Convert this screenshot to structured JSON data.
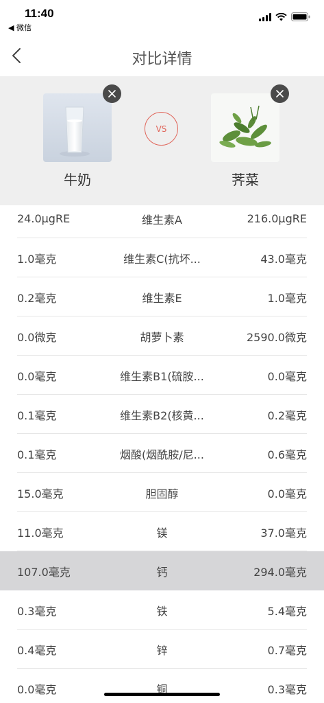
{
  "status_bar": {
    "time": "11:40",
    "back_app": "◀ 微信"
  },
  "nav": {
    "title": "对比详情",
    "back_icon": "chevron-left-icon"
  },
  "compare": {
    "left": {
      "name": "牛奶",
      "image": "milk-glass-image"
    },
    "right": {
      "name": "荠菜",
      "image": "shepherds-purse-image"
    },
    "vs_label": "VS",
    "accent": "#e0655a"
  },
  "rows": [
    {
      "left": "24.0μgRE",
      "name": "维生素A",
      "right": "216.0μgRE"
    },
    {
      "left": "1.0毫克",
      "name": "维生素C(抗坏...",
      "right": "43.0毫克"
    },
    {
      "left": "0.2毫克",
      "name": "维生素E",
      "right": "1.0毫克"
    },
    {
      "left": "0.0微克",
      "name": "胡萝卜素",
      "right": "2590.0微克"
    },
    {
      "left": "0.0毫克",
      "name": "维生素B1(硫胺...",
      "right": "0.0毫克"
    },
    {
      "left": "0.1毫克",
      "name": "维生素B2(核黄...",
      "right": "0.2毫克"
    },
    {
      "left": "0.1毫克",
      "name": "烟酸(烟酰胺/尼...",
      "right": "0.6毫克"
    },
    {
      "left": "15.0毫克",
      "name": "胆固醇",
      "right": "0.0毫克"
    },
    {
      "left": "11.0毫克",
      "name": "镁",
      "right": "37.0毫克"
    },
    {
      "left": "107.0毫克",
      "name": "钙",
      "right": "294.0毫克"
    },
    {
      "left": "0.3毫克",
      "name": "铁",
      "right": "5.4毫克"
    },
    {
      "left": "0.4毫克",
      "name": "锌",
      "right": "0.7毫克"
    },
    {
      "left": "0.0毫克",
      "name": "铜",
      "right": "0.3毫克"
    }
  ],
  "highlight_row": 9
}
